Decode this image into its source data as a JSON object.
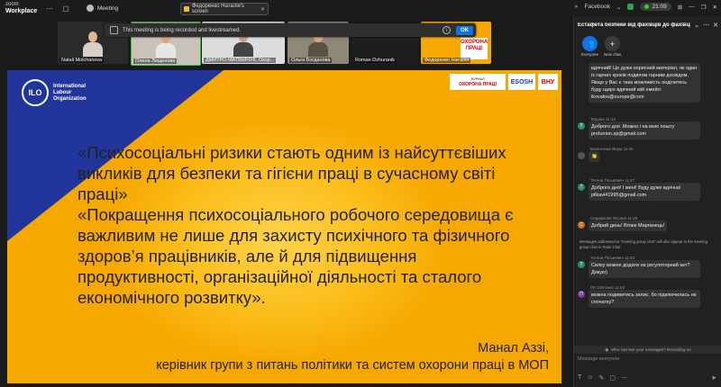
{
  "app": {
    "logo_top": "zoom",
    "logo_bottom": "Workplace"
  },
  "titlebar": {
    "meeting_tab": "Meeting",
    "share_tab": "Федоренко Наталія's screen",
    "facebook": "Facebook",
    "rec_time": "21:09"
  },
  "notice": {
    "text": "This meeting is being recorded and livestreamed.",
    "ok_label": "OK"
  },
  "participants": [
    {
      "name": "Natali Molchanova"
    },
    {
      "name": "Олена Лищенова"
    },
    {
      "name": "ДМИТРО МАТВІЙЧУК, Охор..."
    },
    {
      "name": "Ольга Богданова"
    },
    {
      "name": "Roman Dzhuranik"
    },
    {
      "name": "Федоренко Наталія"
    }
  ],
  "slide": {
    "org": [
      "International",
      "Labour",
      "Organization"
    ],
    "logo1": [
      "ЖУРНАЛ",
      "ОХОРОНА ПРАЦІ"
    ],
    "logo2": "ESOSH",
    "logo3": "ВНУ",
    "quote1": "«Психосоціальні ризики стають одним із найсуттєвіших викликів для безпеки та гігієни праці в сучасному світі праці»",
    "quote2": "«Покращення психосоціального робочого середовища є важливим не лише для захисту психічного та фізичного здоров’я працівників, але й для підвищення продуктивності, організаційної діяльності та сталого економічного розвитку».",
    "author": "Манал Аззі,",
    "author_role": "керівник групи з питань політики та систем охорони праці в МОП"
  },
  "chat": {
    "title": "Естафета безпеки від фахівців до фахівців...",
    "everyone_label": "Everyone",
    "new_chat_label": "New chat",
    "messages": [
      {
        "text": "вдячний! Це дуже корисний матеріал, як один із гарних кроків подвлом гарним досвідом. Якщо у Вас є така можливість поділитись буду щиро вдячний мій емейл: ikovalos@europe@com"
      },
      {
        "who": "Tatyana 11:44",
        "avatar": "T",
        "text": "Доброго дня .Можно і на мою пошту profunion.zp@gmail.com"
      },
      {
        "who": "Валентина Януш 11:46",
        "avatar": "",
        "text": "👏"
      },
      {
        "who": "Тетяна Пільвевич 11:47",
        "avatar": "T",
        "text": "Доброго дня! І мені! Буду дуже вдячна! pilkavi41995@gmail.com"
      },
      {
        "who": "Сердюкова Оксана 11:49",
        "avatar": "С",
        "text": "Добрий день! Вітаю Марганець!"
      },
      {
        "who": "Тетяна Пільвевич 11:53",
        "avatar": "T",
        "text": "Силку можно додати на регуляторний акт? Дякую)"
      },
      {
        "who": "ПК Світлана 11:54",
        "avatar": "П",
        "text": "можна подивитись запис, бо підключилась не спочатку?"
      }
    ],
    "system_notice": "Messages addressed to \"meeting group chat\" will also appear in the meeting group chat in Team Chat",
    "visibility": "Who can see your messages? Recording on",
    "compose_placeholder": "Message everyone"
  }
}
